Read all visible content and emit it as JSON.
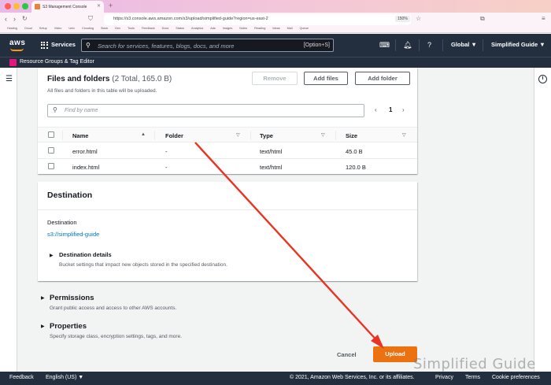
{
  "browser": {
    "tab_title": "S3 Management Console",
    "url": "https://s3.console.aws.amazon.com/s3/upload/simplified-guide?region=us-east-2",
    "zoom": "150%",
    "bookmarks": [
      "Hosting",
      "Cloud",
      "Setup",
      "Video",
      "Unix",
      "Cloudlog",
      "Slack",
      "Dev",
      "Tools",
      "Feedback",
      "Docs",
      "Status",
      "Analytics",
      "Ads",
      "Images",
      "Notes",
      "Reading",
      "Ideas",
      "Mail",
      "Queue"
    ]
  },
  "topbar": {
    "logo": "aws",
    "services_label": "Services",
    "search_placeholder": "Search for services, features, blogs, docs, and more",
    "search_shortcut": "[Option+S]",
    "region_label": "Global ▼",
    "account_label": "Simplified Guide ▼"
  },
  "resource_bar": {
    "label": "Resource Groups & Tag Editor"
  },
  "files": {
    "title": "Files and folders",
    "count": "(2 Total, 165.0 B)",
    "description": "All files and folders in this table will be uploaded.",
    "remove_label": "Remove",
    "add_files_label": "Add files",
    "add_folder_label": "Add folder",
    "filter_placeholder": "Find by name",
    "page": "1",
    "columns": [
      "Name",
      "Folder",
      "Type",
      "Size"
    ],
    "rows": [
      {
        "name": "error.html",
        "folder": "-",
        "type": "text/html",
        "size": "45.0 B"
      },
      {
        "name": "index.html",
        "folder": "-",
        "type": "text/html",
        "size": "120.0 B"
      }
    ]
  },
  "destination": {
    "title": "Destination",
    "label": "Destination",
    "link": "s3://simplified-guide",
    "details_title": "Destination details",
    "details_desc": "Bucket settings that impact new objects stored in the specified destination."
  },
  "permissions": {
    "title": "Permissions",
    "desc": "Grant public access and access to other AWS accounts."
  },
  "properties": {
    "title": "Properties",
    "desc": "Specify storage class, encryption settings, tags, and more."
  },
  "actions": {
    "cancel_label": "Cancel",
    "upload_label": "Upload"
  },
  "footer": {
    "feedback": "Feedback",
    "language": "English (US) ▼",
    "copyright": "© 2021, Amazon Web Services, Inc. or its affiliates.",
    "privacy": "Privacy",
    "terms": "Terms",
    "cookies": "Cookie preferences"
  },
  "watermark": "Simplified Guide",
  "colors": {
    "aws_nav": "#232f3e",
    "upload_button": "#ec7211",
    "link": "#0073bb",
    "annotation_arrow": "#ea3323"
  }
}
